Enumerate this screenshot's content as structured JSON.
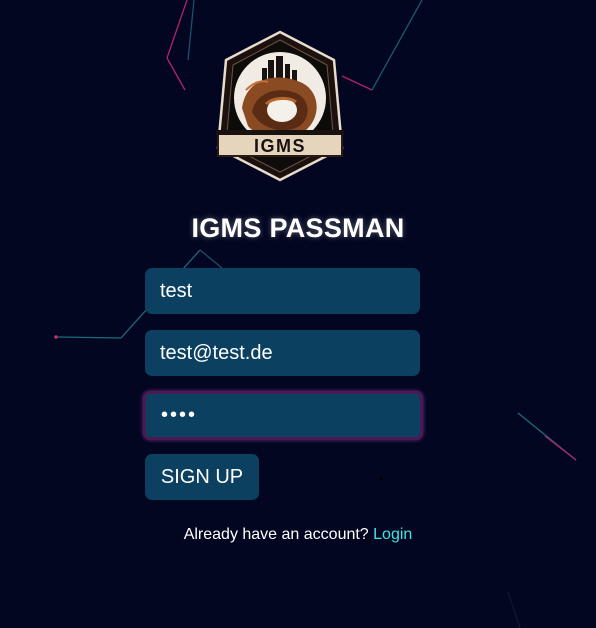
{
  "app": {
    "title": "IGMS PASSMAN",
    "logo_text": "IGMS"
  },
  "form": {
    "username_value": "test",
    "email_value": "test@test.de",
    "password_value": "test",
    "submit_label": "SIGN UP"
  },
  "footer": {
    "prompt_text": "Already have an account?",
    "login_link": "Login"
  },
  "colors": {
    "background": "#020620",
    "field_fill": "#0c4060",
    "link": "#3ee6e6",
    "focus_border": "#4a1a55"
  }
}
